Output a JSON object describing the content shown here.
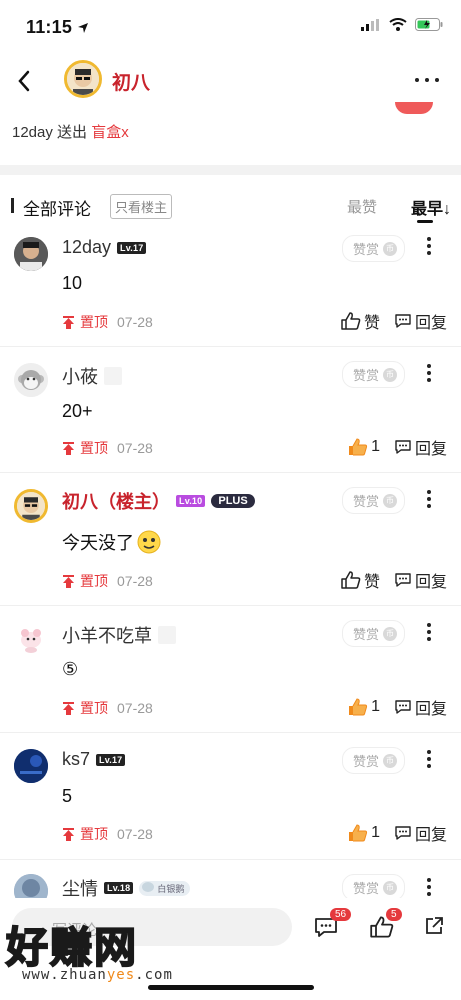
{
  "status": {
    "time": "11:15"
  },
  "header": {
    "name": "初八"
  },
  "gift": {
    "prefix": "12day 送出 ",
    "item": "盲盒",
    "suffix": "x"
  },
  "tabs": {
    "all": "全部评论",
    "only_author": "只看楼主",
    "hot": "最赞",
    "earliest": "最早↓"
  },
  "tip_label": "赞赏",
  "comments": [
    {
      "name": "12day",
      "level": "Lv.17",
      "body": "10",
      "pin": "置顶",
      "date": "07-28",
      "like": "赞",
      "reply": "回复"
    },
    {
      "name": "小莜",
      "body": "20+",
      "pin": "置顶",
      "date": "07-28",
      "like": "1",
      "reply": "回复"
    },
    {
      "name": "初八（楼主）",
      "level": "Lv.10",
      "plus": "PLUS",
      "body": "今天没了",
      "pin": "置顶",
      "date": "07-28",
      "like": "赞",
      "reply": "回复"
    },
    {
      "name": "小羊不吃草",
      "body": "⑤",
      "pin": "置顶",
      "date": "07-28",
      "like": "1",
      "reply": "回复"
    },
    {
      "name": "ks7",
      "level": "Lv.17",
      "body": "5",
      "pin": "置顶",
      "date": "07-28",
      "like": "1",
      "reply": "回复"
    },
    {
      "name": "尘情",
      "level": "Lv.18",
      "badge": "白银鹅"
    }
  ],
  "bottom": {
    "write_placeholder": "写评论",
    "comment_count": "56",
    "like_count": "5"
  },
  "watermark": {
    "big": "好赚网",
    "url_a": "www.zhuan",
    "url_b": "yes",
    "url_c": ".com"
  },
  "colors": {
    "accent_red": "#e5393d",
    "owner_red": "#c8232c",
    "like_orange": "#f08a1b"
  }
}
